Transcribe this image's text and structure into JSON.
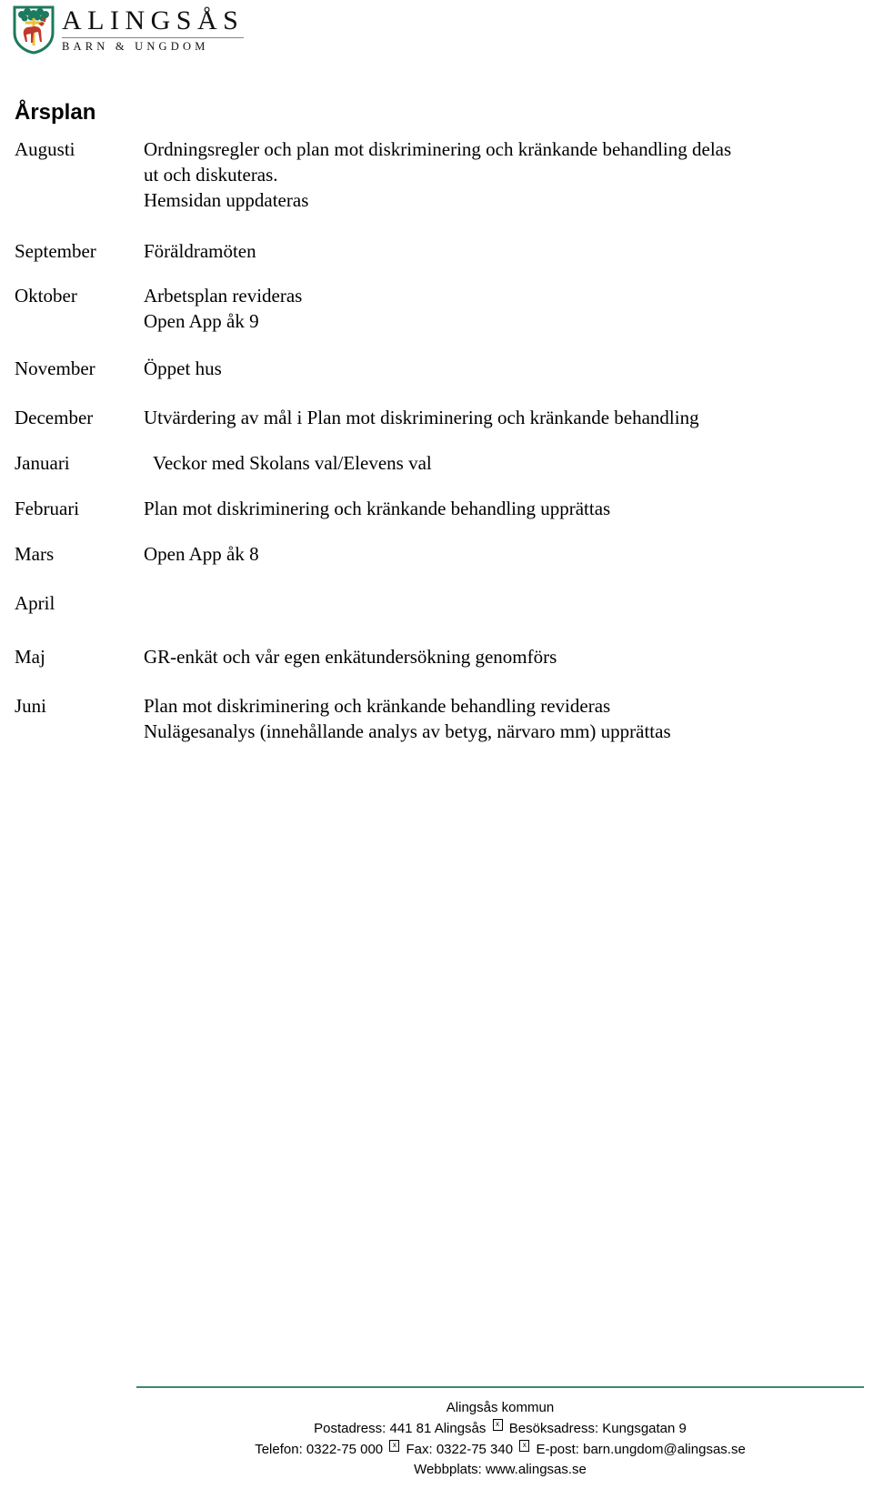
{
  "header": {
    "logo_main": "ALINGSÅS",
    "logo_sub": "BARN & UNGDOM",
    "crest_alt": "alingsas-coat-of-arms"
  },
  "page_title": "Årsplan",
  "plan": {
    "rows": [
      {
        "month": "Augusti",
        "activities": [
          "Ordningsregler och plan mot diskriminering och kränkande behandling delas",
          "ut och diskuteras.",
          "Hemsidan uppdateras"
        ],
        "indent": false,
        "gap_after": 28
      },
      {
        "month": "September",
        "activities": [
          "Föräldramöten"
        ],
        "indent": false,
        "gap_after": 20
      },
      {
        "month": "Oktober",
        "activities": [
          "Arbetsplan revideras",
          "Open App åk 9"
        ],
        "indent": false,
        "gap_after": 24
      },
      {
        "month": "November",
        "activities": [
          "Öppet hus"
        ],
        "indent": false,
        "gap_after": 26
      },
      {
        "month": "December",
        "activities": [
          "Utvärdering av mål i Plan mot diskriminering och kränkande behandling"
        ],
        "indent": false,
        "gap_after": 22
      },
      {
        "month": "Januari",
        "activities": [
          "Veckor med Skolans val/Elevens val"
        ],
        "indent": true,
        "gap_after": 22
      },
      {
        "month": "Februari",
        "activities": [
          "Plan mot diskriminering och kränkande behandling upprättas"
        ],
        "indent": false,
        "gap_after": 22
      },
      {
        "month": "Mars",
        "activities": [
          "Open App åk 8"
        ],
        "indent": false,
        "gap_after": 26
      },
      {
        "month": "April",
        "activities": [],
        "indent": false,
        "gap_after": 30
      },
      {
        "month": "Maj",
        "activities": [
          "GR-enkät och vår egen enkätundersökning genomförs"
        ],
        "indent": false,
        "gap_after": 26
      },
      {
        "month": "Juni",
        "activities": [
          "Plan mot diskriminering och kränkande behandling revideras",
          "Nulägesanalys (innehållande analys av betyg, närvaro mm) upprättas"
        ],
        "indent": false,
        "gap_after": 0
      }
    ]
  },
  "footer": {
    "rule_color": "#3d8a6e",
    "organisation": "Alingsås kommun",
    "address_line": {
      "part1": "Postadress: 441 81 Alingsås",
      "part2": "Besöksadress: Kungsgatan 9"
    },
    "contact_line": {
      "part1": "Telefon: 0322-75 000",
      "part2": "Fax: 0322-75 340",
      "part3": "E-post: barn.ungdom@alingsas.se"
    },
    "web_line": "Webbplats: www.alingsas.se",
    "separator_glyph": "x"
  }
}
